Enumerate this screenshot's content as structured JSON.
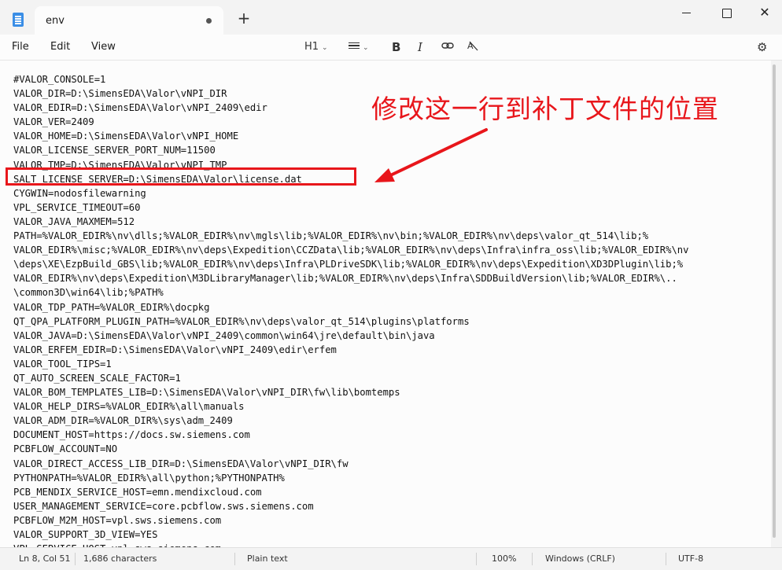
{
  "window": {
    "tab_title": "env",
    "new_tab": "+",
    "min": "",
    "max": "",
    "close": "✕"
  },
  "menu": {
    "file": "File",
    "edit": "Edit",
    "view": "View"
  },
  "toolbar": {
    "heading": "H1",
    "bold": "B",
    "italic": "I",
    "link_icon": "link-icon",
    "clear_format_icon": "clear-formatting-icon",
    "settings_icon": "gear-icon"
  },
  "editor": {
    "lines": [
      "#VALOR_CONSOLE=1",
      "VALOR_DIR=D:\\SimensEDA\\Valor\\vNPI_DIR",
      "VALOR_EDIR=D:\\SimensEDA\\Valor\\vNPI_2409\\edir",
      "VALOR_VER=2409",
      "VALOR_HOME=D:\\SimensEDA\\Valor\\vNPI_HOME",
      "VALOR_LICENSE_SERVER_PORT_NUM=11500",
      "VALOR_TMP=D:\\SimensEDA\\Valor\\vNPI_TMP",
      "SALT_LICENSE_SERVER=D:\\SimensEDA\\Valor\\license.dat",
      "CYGWIN=nodosfilewarning",
      "VPL_SERVICE_TIMEOUT=60",
      "VALOR_JAVA_MAXMEM=512",
      "PATH=%VALOR_EDIR%\\nv\\dlls;%VALOR_EDIR%\\nv\\mgls\\lib;%VALOR_EDIR%\\nv\\bin;%VALOR_EDIR%\\nv\\deps\\valor_qt_514\\lib;%",
      "VALOR_EDIR%\\misc;%VALOR_EDIR%\\nv\\deps\\Expedition\\CCZData\\lib;%VALOR_EDIR%\\nv\\deps\\Infra\\infra_oss\\lib;%VALOR_EDIR%\\nv",
      "\\deps\\XE\\EzpBuild_GBS\\lib;%VALOR_EDIR%\\nv\\deps\\Infra\\PLDriveSDK\\lib;%VALOR_EDIR%\\nv\\deps\\Expedition\\XD3DPlugin\\lib;%",
      "VALOR_EDIR%\\nv\\deps\\Expedition\\M3DLibraryManager\\lib;%VALOR_EDIR%\\nv\\deps\\Infra\\SDDBuildVersion\\lib;%VALOR_EDIR%\\..",
      "\\common3D\\win64\\lib;%PATH%",
      "VALOR_TDP_PATH=%VALOR_EDIR%\\docpkg",
      "QT_QPA_PLATFORM_PLUGIN_PATH=%VALOR_EDIR%\\nv\\deps\\valor_qt_514\\plugins\\platforms",
      "VALOR_JAVA=D:\\SimensEDA\\Valor\\vNPI_2409\\common\\win64\\jre\\default\\bin\\java",
      "VALOR_ERFEM_EDIR=D:\\SimensEDA\\Valor\\vNPI_2409\\edir\\erfem",
      "VALOR_TOOL_TIPS=1",
      "QT_AUTO_SCREEN_SCALE_FACTOR=1",
      "VALOR_BOM_TEMPLATES_LIB=D:\\SimensEDA\\Valor\\vNPI_DIR\\fw\\lib\\bomtemps",
      "VALOR_HELP_DIRS=%VALOR_EDIR%\\all\\manuals",
      "VALOR_ADM_DIR=%VALOR_DIR%\\sys\\adm_2409",
      "DOCUMENT_HOST=https://docs.sw.siemens.com",
      "PCBFLOW_ACCOUNT=NO",
      "VALOR_DIRECT_ACCESS_LIB_DIR=D:\\SimensEDA\\Valor\\vNPI_DIR\\fw",
      "PYTHONPATH=%VALOR_EDIR%\\all\\python;%PYTHONPATH%",
      "PCB_MENDIX_SERVICE_HOST=emn.mendixcloud.com",
      "USER_MANAGEMENT_SERVICE=core.pcbflow.sws.siemens.com",
      "PCBFLOW_M2M_HOST=vpl.sws.siemens.com",
      "VALOR_SUPPORT_3D_VIEW=YES",
      "VPL_SERVICE_HOST=vpl.sws.siemens.com"
    ]
  },
  "annotation": {
    "text": "修改这一行到补丁文件的位置",
    "color": "#e8161b"
  },
  "statusbar": {
    "position": "Ln 8, Col 51",
    "characters": "1,686 characters",
    "format": "Plain text",
    "zoom": "100%",
    "line_ending": "Windows (CRLF)",
    "encoding": "UTF-8"
  }
}
